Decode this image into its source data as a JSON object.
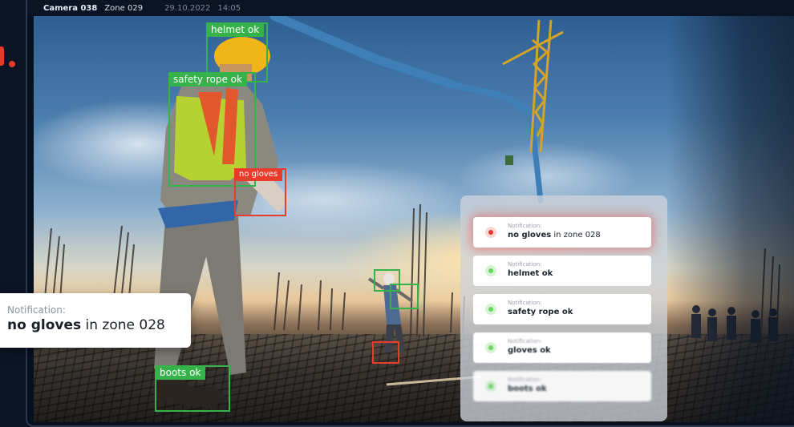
{
  "camera": {
    "name": "Camera 038",
    "zone": "Zone 029",
    "date": "29.10.2022",
    "time": "14:05"
  },
  "detections": [
    {
      "label": "helmet ok",
      "status": "ok"
    },
    {
      "label": "safety rope ok",
      "status": "ok"
    },
    {
      "label": "no gloves",
      "status": "violation"
    },
    {
      "label": "boots ok",
      "status": "ok"
    }
  ],
  "notifications_panel": {
    "items": [
      {
        "caption": "Notification:",
        "bold": "no gloves",
        "rest": " in zone 028",
        "status": "alert"
      },
      {
        "caption": "Notification:",
        "bold": "helmet ok",
        "rest": "",
        "status": "ok"
      },
      {
        "caption": "Notification:",
        "bold": "safety rope ok",
        "rest": "",
        "status": "ok"
      },
      {
        "caption": "Notification:",
        "bold": "gloves ok",
        "rest": "",
        "status": "ok"
      },
      {
        "caption": "Notification:",
        "bold": "boots ok",
        "rest": "",
        "status": "ok"
      }
    ]
  },
  "floating_notification": {
    "caption": "Notification:",
    "bold": "no gloves",
    "rest": " in zone 028"
  },
  "colors": {
    "ok": "#35b34a",
    "violation": "#ea3c2c",
    "background": "#0b1424"
  }
}
